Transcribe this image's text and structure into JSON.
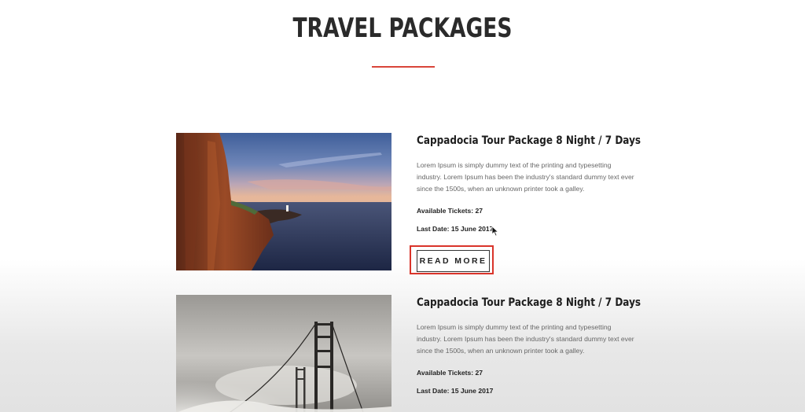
{
  "header": {
    "title": "TRAVEL PACKAGES",
    "divider_color": "#d9453a"
  },
  "packages": [
    {
      "title": "Cappadocia Tour Package 8 Night / 7 Days",
      "description": "Lorem Ipsum is simply dummy text of the printing and typesetting industry. Lorem Ipsum has been the industry's standard dummy text ever since the 1500s, when an unknown printer took a galley.",
      "tickets": "Available Tickets: 27",
      "last_date": "Last Date: 15 June 2017",
      "button_label": "READ MORE",
      "button_highlighted": true,
      "image": "coastal-cliffs-lighthouse-sunset"
    },
    {
      "title": "Cappadocia Tour Package 8 Night / 7 Days",
      "description": "Lorem Ipsum is simply dummy text of the printing and typesetting industry. Lorem Ipsum has been the industry's standard dummy text ever since the 1500s, when an unknown printer took a galley.",
      "tickets": "Available Tickets: 27",
      "last_date": "Last Date: 15 June 2017",
      "image": "golden-gate-bridge-fog"
    }
  ],
  "colors": {
    "highlight": "#d9342a",
    "title": "#2a2a2a",
    "body_text": "#666666"
  }
}
